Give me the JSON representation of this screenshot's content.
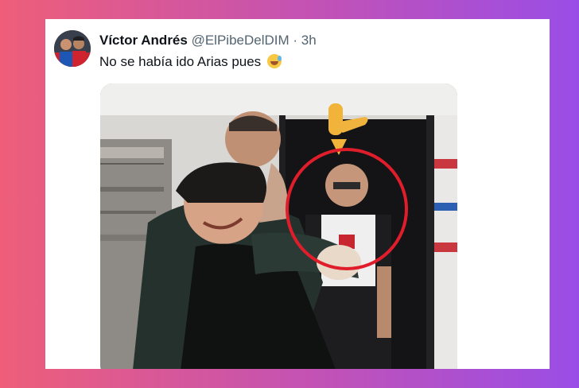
{
  "tweet": {
    "author_name": "Víctor Andrés",
    "author_handle": "@ElPibeDelDIM",
    "separator": "·",
    "time": "3h",
    "text": "No se había ido Arias pues",
    "emoji_icon": "grinning-face-with-sweat-icon"
  },
  "media": {
    "description_icon": "video-thumbnail",
    "annotation_color": "#e01e2b",
    "pointer_icon": "backhand-index-pointing-down-icon"
  },
  "colors": {
    "background_gradient": [
      "#ee5e79",
      "#c653b0",
      "#9a4de6"
    ],
    "card": "#ffffff",
    "name": "#0f1419",
    "handle": "#536471"
  }
}
